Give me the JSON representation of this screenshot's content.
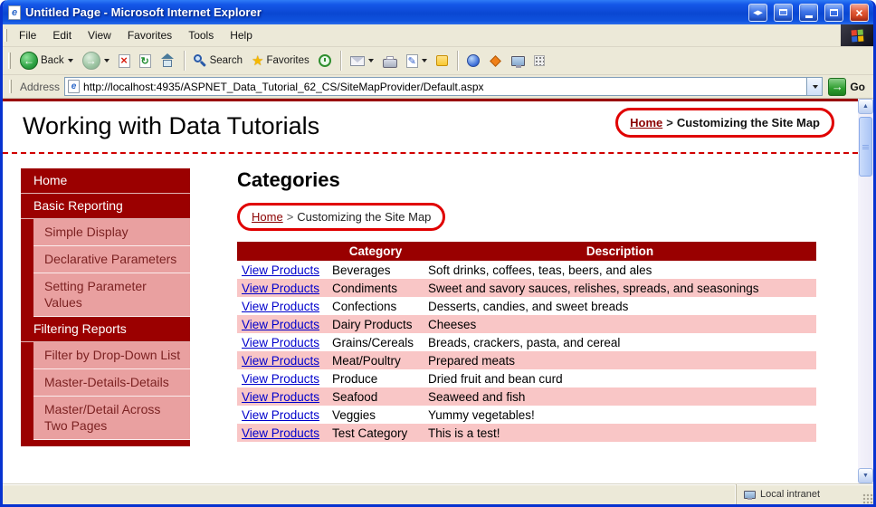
{
  "window": {
    "title": "Untitled Page - Microsoft Internet Explorer"
  },
  "menu": {
    "items": [
      "File",
      "Edit",
      "View",
      "Favorites",
      "Tools",
      "Help"
    ]
  },
  "toolbar": {
    "back_label": "Back",
    "search_label": "Search",
    "favorites_label": "Favorites"
  },
  "address": {
    "label": "Address",
    "url": "http://localhost:4935/ASPNET_Data_Tutorial_62_CS/SiteMapProvider/Default.aspx",
    "go_label": "Go"
  },
  "icons": {
    "back_arrow": "←",
    "forward_arrow": "→",
    "stop_x": "×",
    "refresh": "↻",
    "star": "★",
    "pencil": "✎",
    "close": "×",
    "left_small": "◀",
    "right_small": "▶",
    "scroll_up": "▲",
    "scroll_down": "▼",
    "go_arrow": "→"
  },
  "page": {
    "title": "Working with Data Tutorials",
    "breadcrumb_top": {
      "home": "Home",
      "separator": ">",
      "current": "Customizing the Site Map"
    },
    "sidebar": {
      "items": [
        {
          "label": "Home",
          "level": 0
        },
        {
          "label": "Basic Reporting",
          "level": 0
        },
        {
          "label": "Simple Display",
          "level": 1
        },
        {
          "label": "Declarative Parameters",
          "level": 1
        },
        {
          "label": "Setting Parameter Values",
          "level": 1
        },
        {
          "label": "Filtering Reports",
          "level": 0
        },
        {
          "label": "Filter by Drop-Down List",
          "level": 1
        },
        {
          "label": "Master-Details-Details",
          "level": 1
        },
        {
          "label": "Master/Detail Across Two Pages",
          "level": 1
        }
      ]
    },
    "main": {
      "heading": "Categories",
      "breadcrumb": {
        "home": "Home",
        "separator": ">",
        "current": "Customizing the Site Map"
      },
      "table": {
        "headers": [
          "",
          "Category",
          "Description"
        ],
        "link_label": "View Products",
        "rows": [
          {
            "category": "Beverages",
            "description": "Soft drinks, coffees, teas, beers, and ales"
          },
          {
            "category": "Condiments",
            "description": "Sweet and savory sauces, relishes, spreads, and seasonings"
          },
          {
            "category": "Confections",
            "description": "Desserts, candies, and sweet breads"
          },
          {
            "category": "Dairy Products",
            "description": "Cheeses"
          },
          {
            "category": "Grains/Cereals",
            "description": "Breads, crackers, pasta, and cereal"
          },
          {
            "category": "Meat/Poultry",
            "description": "Prepared meats"
          },
          {
            "category": "Produce",
            "description": "Dried fruit and bean curd"
          },
          {
            "category": "Seafood",
            "description": "Seaweed and fish"
          },
          {
            "category": "Veggies",
            "description": "Yummy vegetables!"
          },
          {
            "category": "Test Category",
            "description": "This is a test!"
          }
        ]
      }
    }
  },
  "statusbar": {
    "zone_label": "Local intranet"
  },
  "colors": {
    "titlebar_blue": "#0F52DE",
    "chrome_tan": "#ECE9D8",
    "dark_red": "#990000",
    "sidebar_pink": "#E9A0A0",
    "row_pink": "#F9C6C6",
    "link_blue": "#0000CC",
    "annotation_red": "#E00000"
  }
}
